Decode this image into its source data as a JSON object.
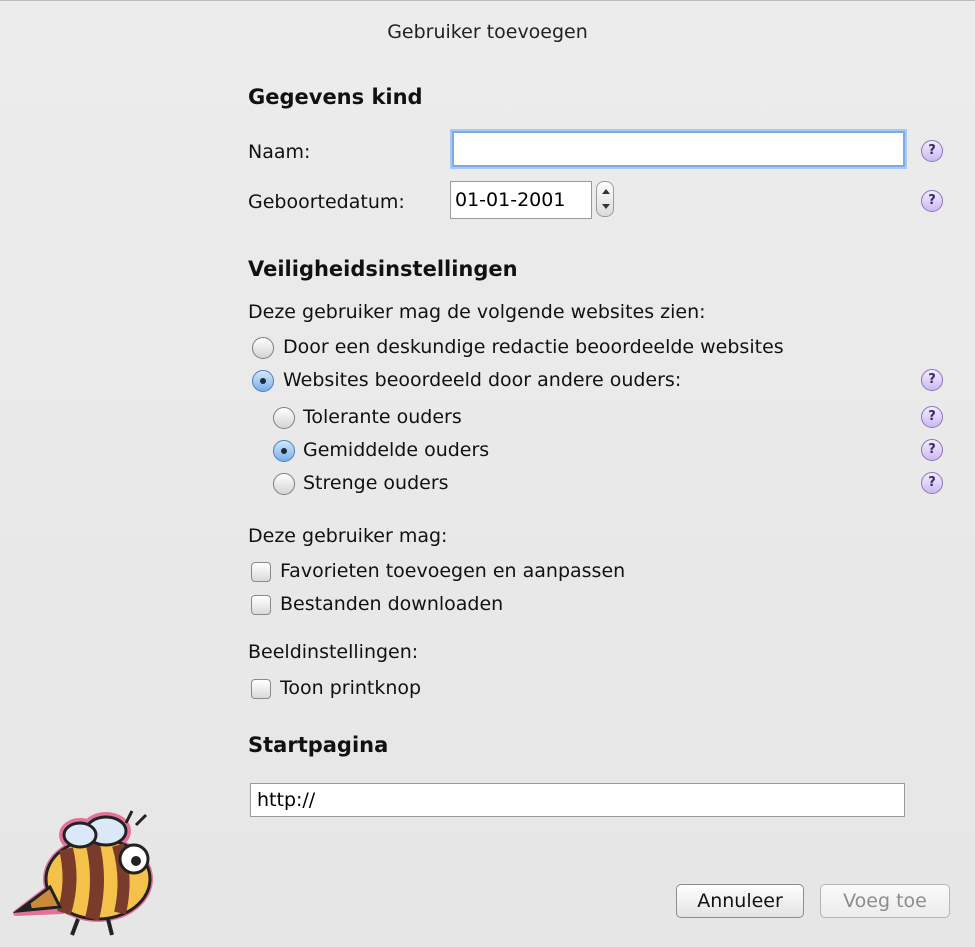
{
  "window": {
    "title": "Gebruiker toevoegen"
  },
  "child": {
    "heading": "Gegevens kind",
    "name_label": "Naam:",
    "name_value": "",
    "birthdate_label": "Geboortedatum:",
    "birthdate_value": "01-01-2001"
  },
  "security": {
    "heading": "Veiligheidsinstellingen",
    "websites_intro": "Deze gebruiker mag de volgende websites zien:",
    "options": [
      {
        "label": "Door een deskundige redactie beoordeelde websites",
        "selected": false
      },
      {
        "label": "Websites beoordeeld door andere ouders:",
        "selected": true
      }
    ],
    "parent_levels": [
      {
        "label": "Tolerante ouders",
        "selected": false
      },
      {
        "label": "Gemiddelde ouders",
        "selected": true
      },
      {
        "label": "Strenge ouders",
        "selected": false
      }
    ],
    "permissions_intro": "Deze gebruiker mag:",
    "permissions": [
      {
        "label": "Favorieten toevoegen en aanpassen",
        "checked": false
      },
      {
        "label": "Bestanden downloaden",
        "checked": false
      }
    ],
    "display_intro": "Beeldinstellingen:",
    "display": [
      {
        "label": "Toon printknop",
        "checked": false
      }
    ]
  },
  "startpage": {
    "heading": "Startpagina",
    "value": "http://"
  },
  "buttons": {
    "cancel": "Annuleer",
    "add": "Voeg toe"
  },
  "icons": {
    "help": "help-icon",
    "logo": "bee-mascot-logo"
  },
  "help_glyph": "?"
}
